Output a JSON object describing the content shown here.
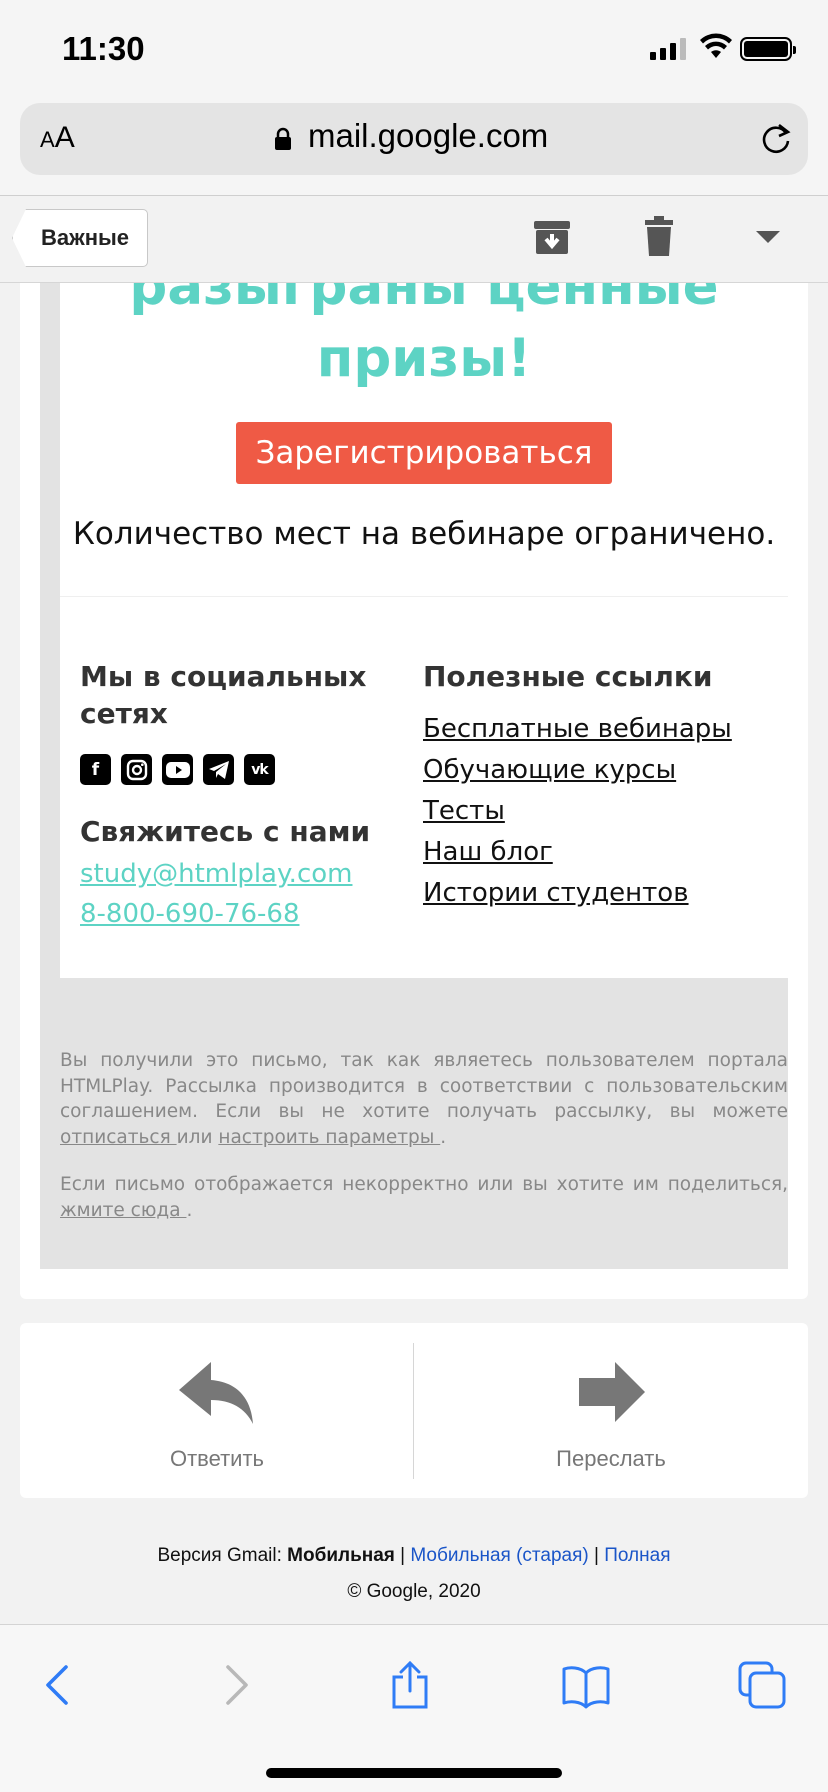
{
  "status": {
    "time": "11:30"
  },
  "browser": {
    "text_size_label": "AA",
    "url": "mail.google.com"
  },
  "gmail_header": {
    "back_label": "Важные"
  },
  "email": {
    "headline": "разыграны ценные призы!",
    "register_button": "Зарегистрироваться",
    "limited_seats": "Количество мест на вебинаре ограничено.",
    "social_heading": "Мы в социальных сетях",
    "socials": [
      "facebook-icon",
      "instagram-icon",
      "youtube-icon",
      "telegram-icon",
      "vk-icon"
    ],
    "contact_heading": "Свяжитесь с нами",
    "contact_email": "study@htmlplay.com",
    "contact_phone": "8-800-690-76-68",
    "useful_heading": "Полезные ссылки",
    "useful_links": [
      "Бесплатные вебинары",
      "Обучающие курсы",
      "Тесты",
      "Наш блог",
      "Истории студентов"
    ],
    "footer_p1_text": "Вы получили это письмо, так как являетесь пользователем портала HTMLPlay. Рассылка производится в соответствии с пользовательским соглашением. Если вы не хотите получать рассылку, вы можете",
    "footer_unsubscribe": "отписаться ",
    "footer_or": "или",
    "footer_settings": "настроить параметры ",
    "footer_p2_text": "Если письмо отображается некорректно или вы хотите им поделиться,",
    "footer_click_here": "жмите сюда ",
    "accent_color": "#5dd3c4",
    "button_color": "#ef5a45"
  },
  "actions": {
    "reply": "Ответить",
    "forward": "Переслать"
  },
  "versions": {
    "prefix": "Версия Gmail:",
    "current": "Мобильная",
    "old_mobile": "Мобильная (старая)",
    "full": "Полная",
    "copyright": "© Google, 2020"
  }
}
